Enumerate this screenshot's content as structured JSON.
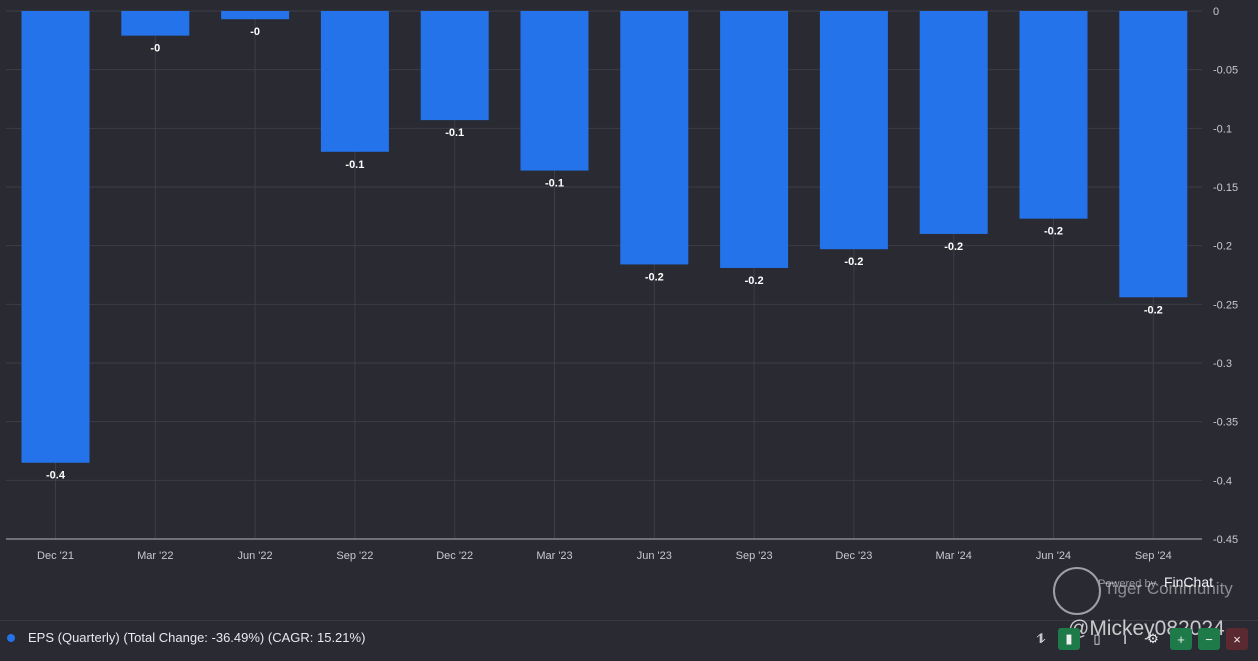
{
  "chart_data": {
    "type": "bar",
    "categories": [
      "Dec '21",
      "Mar '22",
      "Jun '22",
      "Sep '22",
      "Dec '22",
      "Mar '23",
      "Jun '23",
      "Sep '23",
      "Dec '23",
      "Mar '24",
      "Jun '24",
      "Sep '24"
    ],
    "series": [
      {
        "name": "EPS (Quarterly) (Total Change: -36.49%) (CAGR: 15.21%)",
        "values": [
          -0.385,
          -0.021,
          -0.007,
          -0.12,
          -0.093,
          -0.136,
          -0.216,
          -0.219,
          -0.203,
          -0.19,
          -0.177,
          -0.244
        ],
        "data_labels": [
          "-0.4",
          "-0",
          "-0",
          "-0.1",
          "-0.1",
          "-0.1",
          "-0.2",
          "-0.2",
          "-0.2",
          "-0.2",
          "-0.2",
          "-0.2"
        ]
      }
    ],
    "ylim": [
      -0.45,
      0
    ],
    "yticks": [
      0,
      -0.05,
      -0.1,
      -0.15,
      -0.2,
      -0.25,
      -0.3,
      -0.35,
      -0.4,
      -0.45
    ],
    "ytick_labels": [
      "0",
      "-0.05",
      "-0.1",
      "-0.15",
      "-0.2",
      "-0.25",
      "-0.3",
      "-0.35",
      "-0.4",
      "-0.45"
    ],
    "y_axis_side": "right",
    "grid": true,
    "legend_position": "bottom-left",
    "bar_color": "#2473ea"
  },
  "legend": {
    "label": "EPS (Quarterly) (Total Change: -36.49%) (CAGR: 15.21%)",
    "dot_color": "#2473ea"
  },
  "branding": {
    "powered_by": "Powered by",
    "name": "FinChat"
  },
  "watermark": {
    "name": "Tiger Community",
    "handle": "@Mickey082024"
  },
  "toolbar": {
    "icons": [
      "trend-icon",
      "bar-chart-icon",
      "bar-chart-alt-icon",
      "text-icon",
      "gear-icon",
      "plus-icon",
      "minus-icon",
      "close-icon"
    ]
  }
}
